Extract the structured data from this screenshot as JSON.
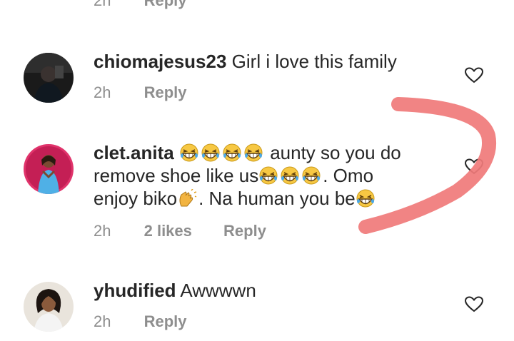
{
  "top_partial": {
    "time": "2h",
    "reply": "Reply"
  },
  "comments": [
    {
      "username": "chiomajesus23",
      "text_parts": [
        "Girl i love this family"
      ],
      "time": "2h",
      "likes": "",
      "reply": "Reply"
    },
    {
      "username": "clet.anita",
      "text_parts": [
        "aunty so you do",
        "remove shoe like us",
        ". Omo",
        "enjoy biko",
        ". Na human you be"
      ],
      "time": "2h",
      "likes": "2 likes",
      "reply": "Reply"
    },
    {
      "username": "yhudified",
      "text_parts": [
        "Awwwwn"
      ],
      "time": "2h",
      "likes": "",
      "reply": "Reply"
    }
  ],
  "icons": {
    "like": "heart-outline-icon",
    "laugh": "grinning-squinting-face-emoji",
    "clap": "clapping-hands-emoji"
  },
  "colors": {
    "text": "#262626",
    "secondary": "#8e8e8e",
    "annotation_stroke": "#f07a7a"
  }
}
